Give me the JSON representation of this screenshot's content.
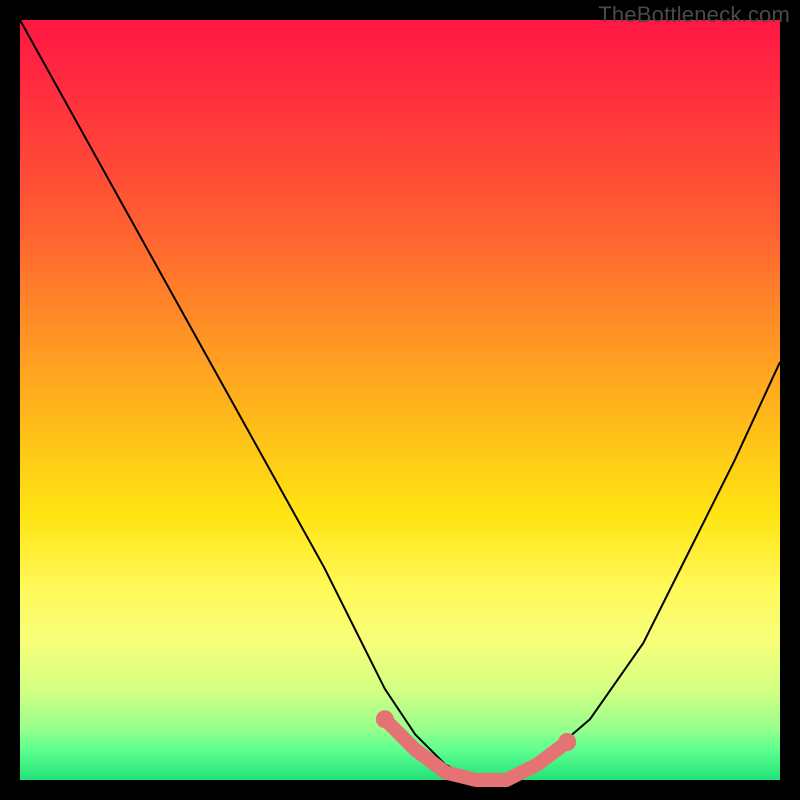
{
  "watermark": "TheBottleneck.com",
  "colors": {
    "background": "#000000",
    "curve": "#000000",
    "accent": "#e57373",
    "gradient_top": "#ff1744",
    "gradient_bottom": "#22e27a"
  },
  "chart_data": {
    "type": "line",
    "title": "",
    "xlabel": "",
    "ylabel": "",
    "xlim": [
      0,
      100
    ],
    "ylim": [
      0,
      100
    ],
    "grid": false,
    "legend": false,
    "series": [
      {
        "name": "bottleneck-curve",
        "x": [
          0,
          10,
          20,
          30,
          40,
          48,
          52,
          56,
          60,
          64,
          68,
          75,
          82,
          88,
          94,
          100
        ],
        "values": [
          100,
          82,
          64,
          46,
          28,
          12,
          6,
          2,
          0,
          0,
          2,
          8,
          18,
          30,
          42,
          55
        ]
      }
    ],
    "accent_segment": {
      "name": "bottleneck-sweet-spot",
      "x": [
        48,
        52,
        56,
        60,
        64,
        68,
        72
      ],
      "values": [
        8,
        4,
        1,
        0,
        0,
        2,
        5
      ]
    }
  }
}
